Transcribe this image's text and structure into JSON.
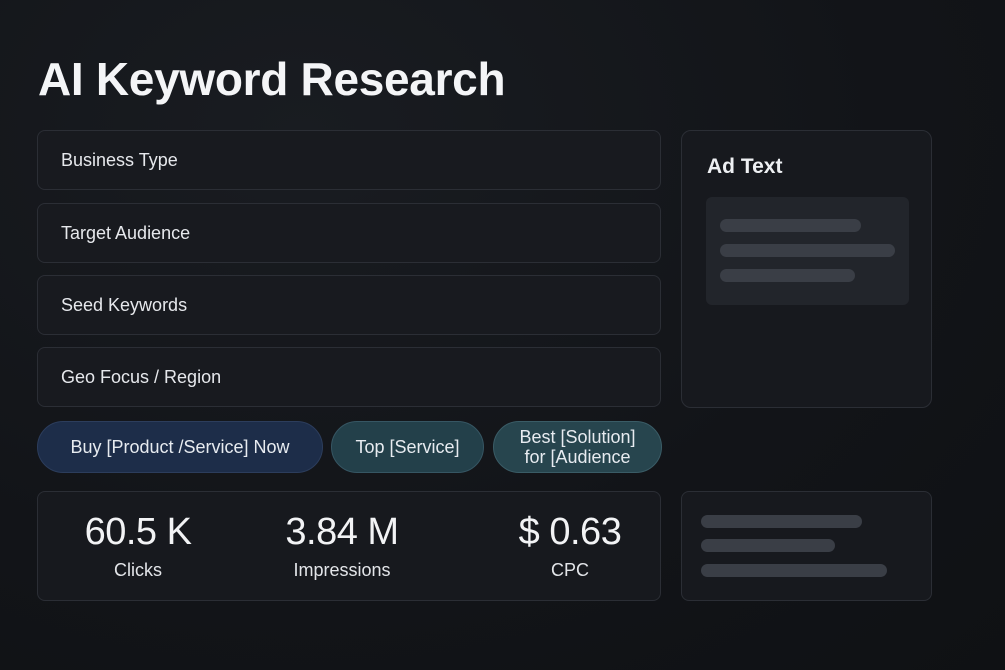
{
  "page": {
    "title": "AI Keyword Research"
  },
  "form": {
    "business_type": "Business Type",
    "target_audience": "Target Audience",
    "seed_keywords": "Seed Keywords",
    "geo_focus": "Geo Focus / Region"
  },
  "ad_panel": {
    "title": "Ad Text"
  },
  "chips": [
    {
      "label": "Buy [Product /Service] Now",
      "color": "#1d2d49"
    },
    {
      "label": "Top [Service]",
      "color": "#23404a"
    },
    {
      "label_line1": "Best [Solution]",
      "label_line2": "for [Audience",
      "color": "#27454e"
    }
  ],
  "stats": {
    "clicks": {
      "value": "60.5 K",
      "label": "Clicks"
    },
    "impressions": {
      "value": "3.84 M",
      "label": "Impressions"
    },
    "cpc": {
      "value": "$ 0.63",
      "label": "CPC"
    }
  },
  "colors": {
    "background": "#121418",
    "panel": "#17191e",
    "border": "#2b2e35",
    "skeleton": "#3a3e46"
  }
}
